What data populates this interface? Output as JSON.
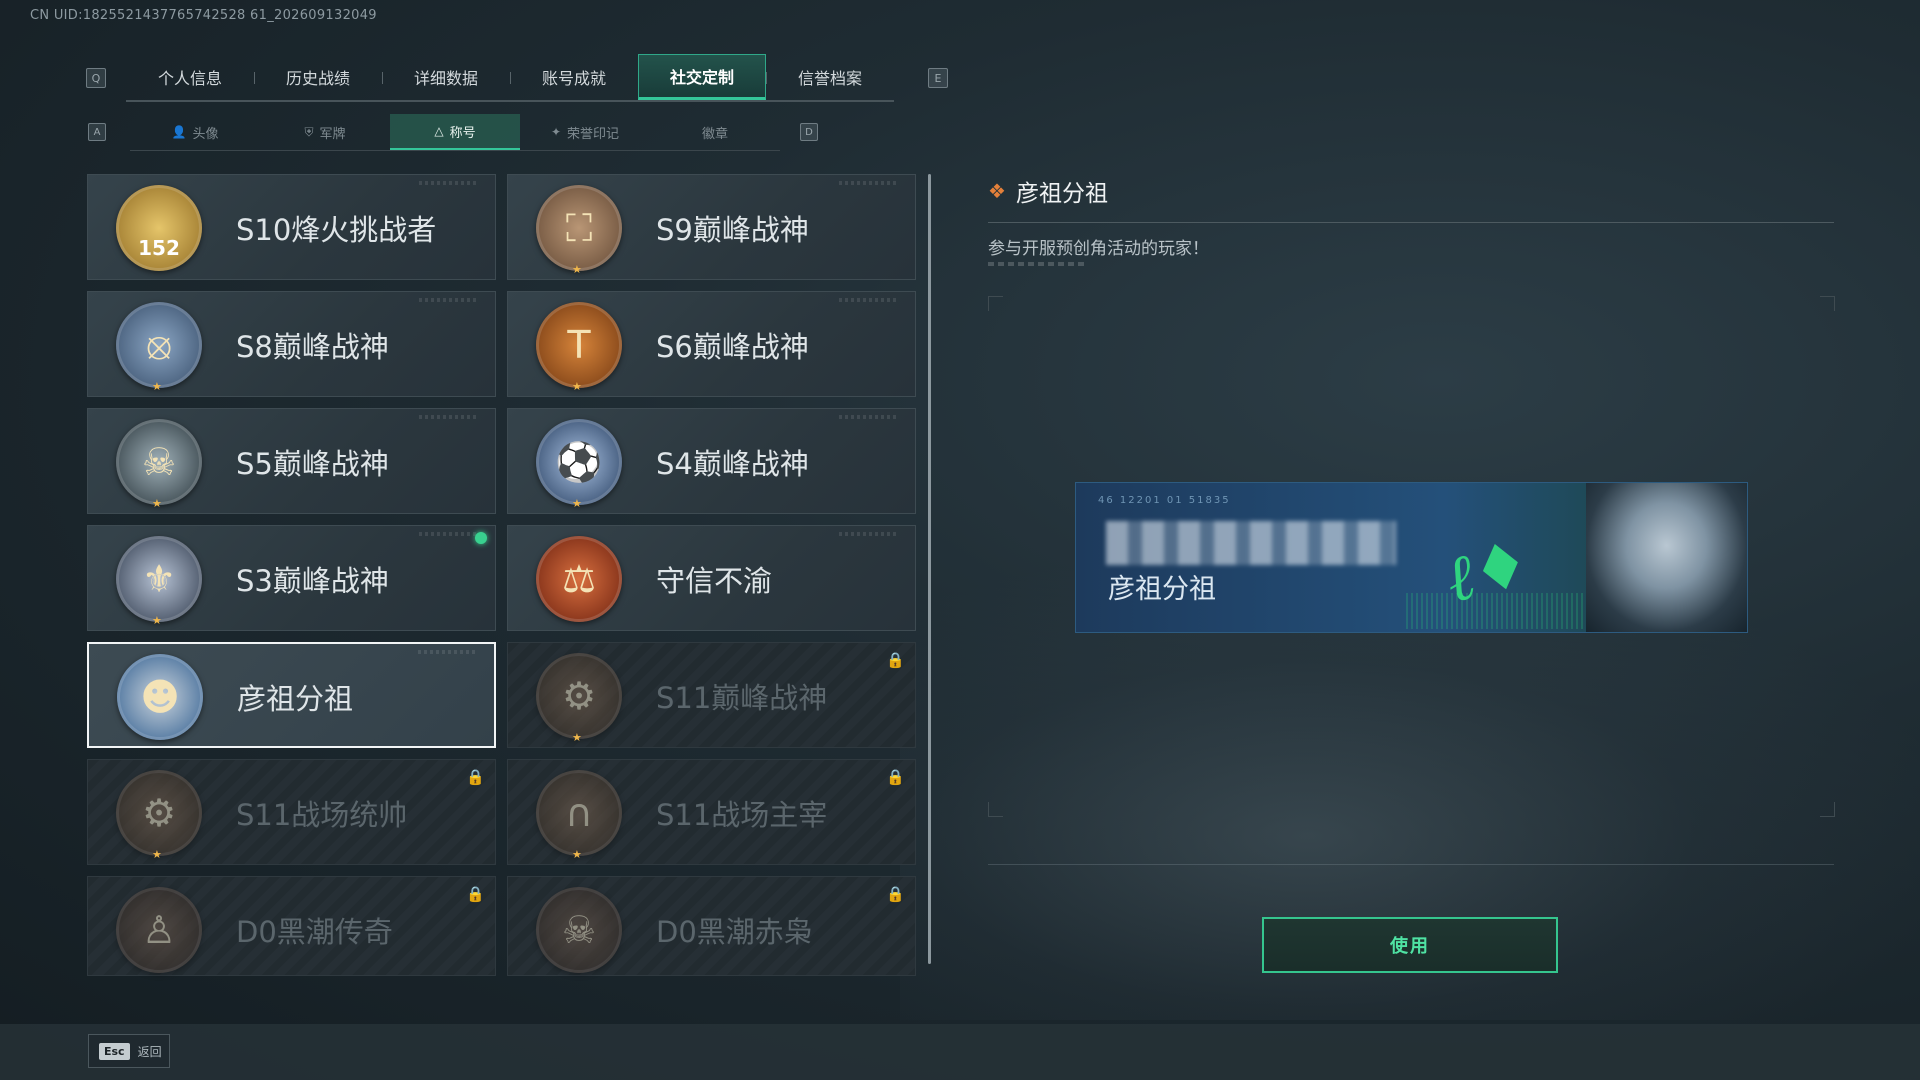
{
  "uid": "CN UID:1825521437765742528 61_202609132049",
  "keys": {
    "prev_tab": "Q",
    "next_tab": "E",
    "prev_sub": "A",
    "next_sub": "D",
    "back": "Esc"
  },
  "tabs": [
    {
      "label": "个人信息",
      "active": false
    },
    {
      "label": "历史战绩",
      "active": false
    },
    {
      "label": "详细数据",
      "active": false
    },
    {
      "label": "账号成就",
      "active": false
    },
    {
      "label": "社交定制",
      "active": true
    },
    {
      "label": "信誉档案",
      "active": false
    }
  ],
  "subtabs": [
    {
      "label": "头像",
      "icon": "person-icon",
      "active": false
    },
    {
      "label": "军牌",
      "icon": "dogtag-icon",
      "active": false
    },
    {
      "label": "称号",
      "icon": "title-icon",
      "active": true
    },
    {
      "label": "荣誉印记",
      "icon": "honor-mark-icon",
      "active": false
    },
    {
      "label": "徽章",
      "icon": "",
      "active": false
    }
  ],
  "titles": [
    {
      "name": "S10烽火挑战者",
      "badge_text": "152",
      "badge_color": "#c9a24a",
      "locked": false,
      "selected": false,
      "new": false
    },
    {
      "name": "S9巅峰战神",
      "badge_text": "",
      "badge_color": "#8a6f55",
      "locked": false,
      "selected": false,
      "new": false
    },
    {
      "name": "S8巅峰战神",
      "badge_text": "",
      "badge_color": "#4d6c8f",
      "locked": false,
      "selected": false,
      "new": false
    },
    {
      "name": "S6巅峰战神",
      "badge_text": "",
      "badge_color": "#a05a22",
      "locked": false,
      "selected": false,
      "new": false
    },
    {
      "name": "S5巅峰战神",
      "badge_text": "",
      "badge_color": "#3a4d55",
      "locked": false,
      "selected": false,
      "new": false
    },
    {
      "name": "S4巅峰战神",
      "badge_text": "",
      "badge_color": "#3b5d86",
      "locked": false,
      "selected": false,
      "new": false
    },
    {
      "name": "S3巅峰战神",
      "badge_text": "",
      "badge_color": "#3c4a5e",
      "locked": false,
      "selected": false,
      "new": true
    },
    {
      "name": "守信不渝",
      "badge_text": "",
      "badge_color": "#9c3a1f",
      "locked": false,
      "selected": false,
      "new": false
    },
    {
      "name": "彦祖分祖",
      "badge_text": "",
      "badge_color": "#3f72a8",
      "locked": false,
      "selected": true,
      "new": false
    },
    {
      "name": "S11巅峰战神",
      "badge_text": "",
      "badge_color": "#6b4a31",
      "locked": true,
      "selected": false,
      "new": false
    },
    {
      "name": "S11战场统帅",
      "badge_text": "",
      "badge_color": "#6b4a31",
      "locked": true,
      "selected": false,
      "new": false
    },
    {
      "name": "S11战场主宰",
      "badge_text": "",
      "badge_color": "#6b4a31",
      "locked": true,
      "selected": false,
      "new": false
    },
    {
      "name": "D0黑潮传奇",
      "badge_text": "",
      "badge_color": "#5e4030",
      "locked": true,
      "selected": false,
      "new": false
    },
    {
      "name": "D0黑潮赤枭",
      "badge_text": "",
      "badge_color": "#5e4030",
      "locked": true,
      "selected": false,
      "new": false
    }
  ],
  "detail": {
    "title": "彦祖分祖",
    "description": "参与开服预创角活动的玩家！",
    "banner_title": "彦祖分祖",
    "banner_codes": "46 12201   01 51835"
  },
  "actions": {
    "use_label": "使用",
    "back_label": "返回"
  },
  "colors": {
    "accent": "#34c79a",
    "title_diamond": "#e4803a",
    "new_dot": "#39d18f"
  }
}
